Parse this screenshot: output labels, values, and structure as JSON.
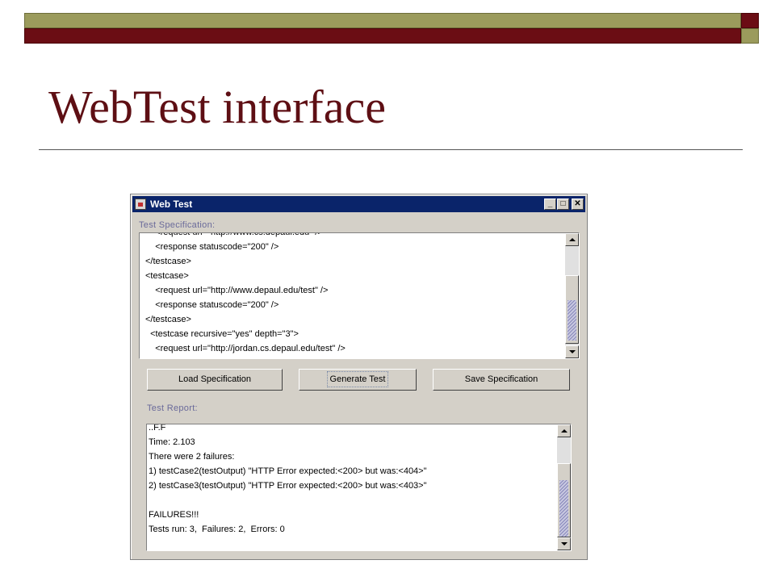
{
  "slide": {
    "title": "WebTest interface",
    "colors": {
      "maroon": "#6b0d14",
      "olive": "#9b9b5c"
    }
  },
  "window": {
    "title": "Web Test",
    "icon": "java-coffee-cup-icon",
    "controls": {
      "minimize": "_",
      "maximize": "□",
      "close": "✕"
    },
    "spec_label": "Test Specification:",
    "spec_lines": [
      "    <request url=\"http://www.cs.depaul.edu\" />",
      "    <response statuscode=\"200\" />",
      "</testcase>",
      "<testcase>",
      "    <request url=\"http://www.depaul.edu/test\" />",
      "    <response statuscode=\"200\" />",
      "</testcase>",
      "  <testcase recursive=\"yes\" depth=\"3\">",
      "    <request url=\"http://jordan.cs.depaul.edu/test\" />"
    ],
    "buttons": {
      "load": "Load Specification",
      "generate": "Generate Test",
      "save": "Save Specification"
    },
    "report_label": "Test Report:",
    "report_lines": [
      "..F.F",
      "Time: 2.103",
      "There were 2 failures:",
      "1) testCase2(testOutput) \"HTTP Error expected:<200> but was:<404>\"",
      "2) testCase3(testOutput) \"HTTP Error expected:<200> but was:<403>\"",
      "",
      "FAILURES!!!",
      "Tests run: 3,  Failures: 2,  Errors: 0"
    ]
  }
}
